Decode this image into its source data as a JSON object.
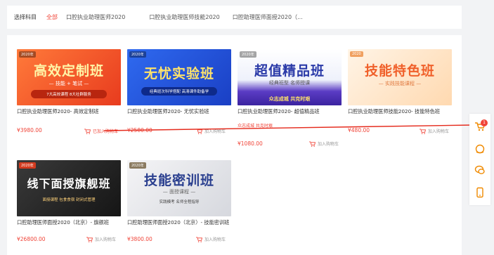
{
  "filter": {
    "label": "选择科目",
    "options": [
      {
        "label": "全部",
        "active": true
      },
      {
        "label": "口腔执业助理医师2020",
        "active": false
      },
      {
        "label": "口腔执业助理医师技能2020",
        "active": false
      },
      {
        "label": "口腔助理医师面授2020（...",
        "active": false
      }
    ]
  },
  "courses": [
    {
      "thumb_tag": "2020年",
      "thumb_title": "高效定制班",
      "thumb_sub": "— 技能 + 笔试 —",
      "thumb_sub2": "7大高效课程  8大社群服务",
      "title": "口腔执业助理医师2020- 高效定制班",
      "promo": "",
      "price": "¥3980.00",
      "cart_label": "已加入购物车",
      "in_cart": true
    },
    {
      "thumb_tag": "2020年",
      "thumb_title": "无忧实验班",
      "thumb_sub": "",
      "thumb_sub2": "经典班次科学搭配 高清课件助备学",
      "title": "口腔执业助理医师2020- 无忧实验班",
      "promo": "",
      "price": "¥2580.00",
      "cart_label": "加入购物车",
      "in_cart": false
    },
    {
      "thumb_tag": "2020年",
      "thumb_title": "超值精品班",
      "thumb_sub": "经典班型  名师授课",
      "thumb_sub2": "众志成城  共克时艰",
      "title": "口腔执业助理医师2020- 超值精品班",
      "promo": "众志成城 共克时艰",
      "price": "¥1080.00",
      "cart_label": "加入购物车",
      "in_cart": false
    },
    {
      "thumb_tag": "2020",
      "thumb_title": "技能特色班",
      "thumb_sub": "— 实践技能课程 —",
      "thumb_sub2": "",
      "title": "口腔执业助理医师技能2020- 技能特色班",
      "promo": "",
      "price": "¥480.00",
      "cart_label": "加入购物车",
      "in_cart": false
    },
    {
      "thumb_tag": "2020年",
      "thumb_title": "线下面授旗舰班",
      "thumb_sub": "",
      "thumb_sub2": "面授课程 包食食宿 封闭式管理",
      "title": "口腔助理医师面授2020（北京）- 旗舰班",
      "promo": "",
      "price": "¥26800.00",
      "cart_label": "加入购物车",
      "in_cart": false
    },
    {
      "thumb_tag": "2020年",
      "thumb_title": "技能密训班",
      "thumb_sub": "— 面授课程 —",
      "thumb_sub2": "实践模考 名师全程指导",
      "title": "口腔助理医师面授2020（北京）- 技能密训班",
      "promo": "",
      "price": "¥3800.00",
      "cart_label": "加入购物车",
      "in_cart": false
    }
  ],
  "sidebar": {
    "cart_count": "1",
    "icons": [
      "cart-icon",
      "headset-icon",
      "chat-icon",
      "phone-icon"
    ]
  },
  "colors": {
    "accent": "#f04438"
  }
}
